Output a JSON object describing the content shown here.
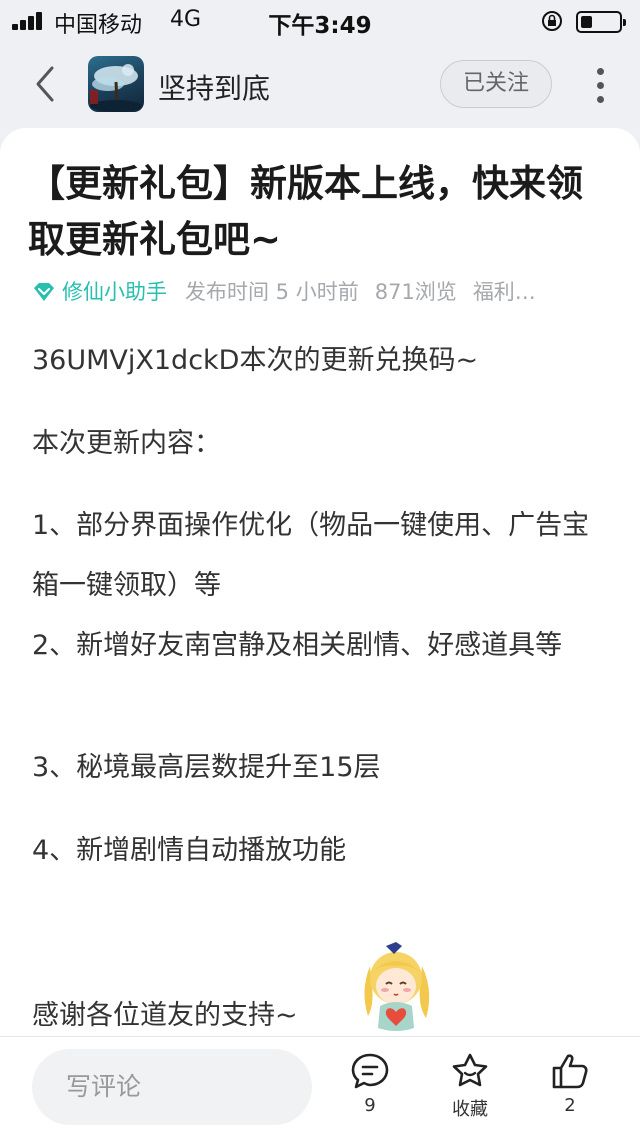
{
  "status_bar": {
    "carrier": "中国移动",
    "network": "4G",
    "time": "下午3:49",
    "battery_level": 0.3
  },
  "nav": {
    "back_icon": "chevron-left-icon",
    "channel_name": "坚持到底",
    "follow_label": "已关注",
    "more_icon": "more-vertical-icon"
  },
  "article": {
    "title": "【更新礼包】新版本上线，快来领取更新礼包吧~",
    "author": "修仙小助手",
    "published": "发布时间 5 小时前",
    "views": "871浏览",
    "tag": "福利…",
    "paragraphs": [
      "36UMVjX1dckD本次的更新兑换码~",
      "本次更新内容：",
      "1、部分界面操作优化（物品一键使用、广告宝箱一键领取）等",
      "2、新增好友南宫静及相关剧情、好感道具等",
      "3、秘境最高层数提升至15层",
      "4、新增剧情自动播放功能",
      "感谢各位道友的支持~"
    ]
  },
  "bottom_bar": {
    "comment_placeholder": "写评论",
    "comments_count": "9",
    "favorite_label": "收藏",
    "likes_count": "2"
  },
  "colors": {
    "accent": "#28bfae",
    "background": "#eef0f3",
    "card": "#ffffff"
  }
}
